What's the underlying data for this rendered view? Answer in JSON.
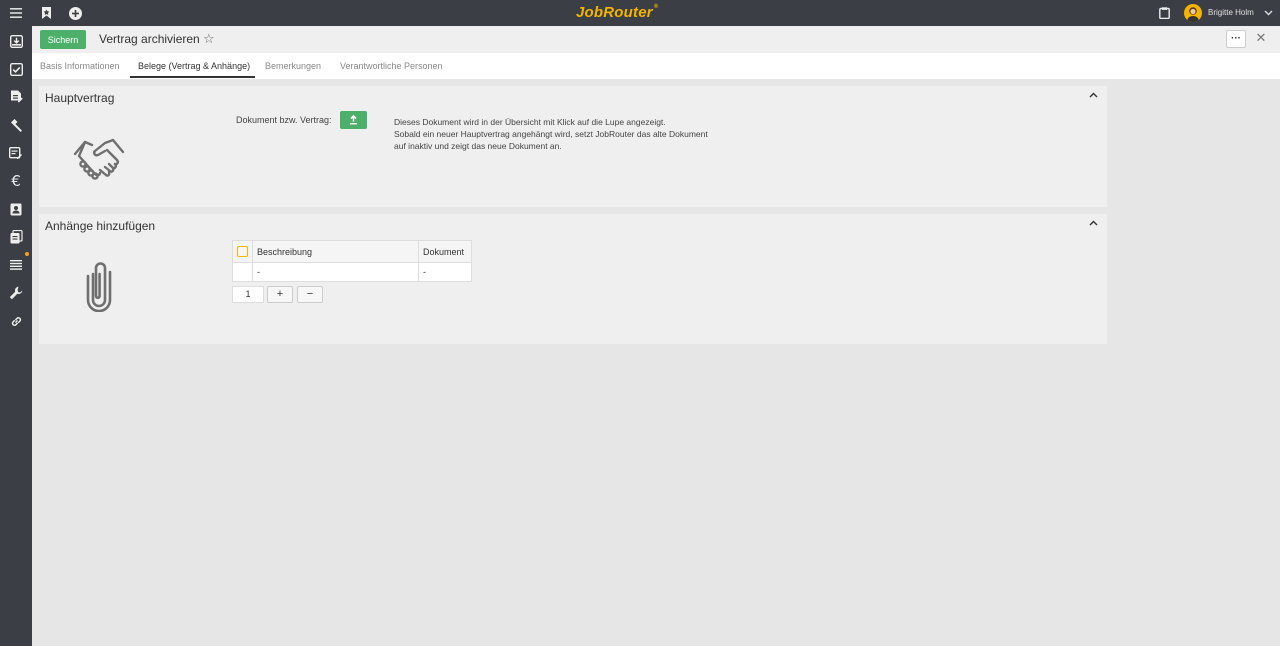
{
  "topbar": {
    "brand": "JobRouter",
    "brand_mark": "®",
    "user_name": "Brigitte Holm",
    "icons": [
      "menu-icon",
      "bookmark-icon",
      "add-circle-icon",
      "clipboard-icon",
      "chevron-down-icon"
    ]
  },
  "sidebar": {
    "items": [
      "inbox-icon",
      "tasks-done-icon",
      "document-edit-icon",
      "hammer-icon",
      "form-edit-icon",
      "euro-icon",
      "contact-card-icon",
      "clipboard-list-icon",
      "list-icon",
      "wrench-icon",
      "link-icon"
    ]
  },
  "header": {
    "save_label": "Sichern",
    "title": "Vertrag archivieren",
    "star": "☆",
    "more": "···",
    "close": "✕"
  },
  "tabs": [
    {
      "label": "Basis Informationen",
      "active": false
    },
    {
      "label": "Belege (Vertrag & Anhänge)",
      "active": true
    },
    {
      "label": "Bemerkungen",
      "active": false
    },
    {
      "label": "Verantwortliche Personen",
      "active": false
    }
  ],
  "sections": {
    "hauptvertrag": {
      "title": "Hauptvertrag",
      "field_label": "Dokument bzw. Vertrag:",
      "info": "Dieses Dokument wird in der Übersicht mit Klick auf die Lupe angezeigt.",
      "info2": "Sobald ein neuer Hauptvertrag angehängt wird, setzt JobRouter das alte Dokument",
      "info3": "auf inaktiv und zeigt das neue Dokument an."
    },
    "anhaenge": {
      "title": "Anhänge hinzufügen",
      "col_desc": "Beschreibung",
      "col_doc": "Dokument",
      "row_desc": "-",
      "row_doc": "-",
      "pager": "1",
      "add": "+",
      "remove": "−"
    }
  },
  "colors": {
    "accent_green": "#4caf6a",
    "brand_yellow": "#f4b400",
    "dark_bar": "#3b3e45"
  }
}
